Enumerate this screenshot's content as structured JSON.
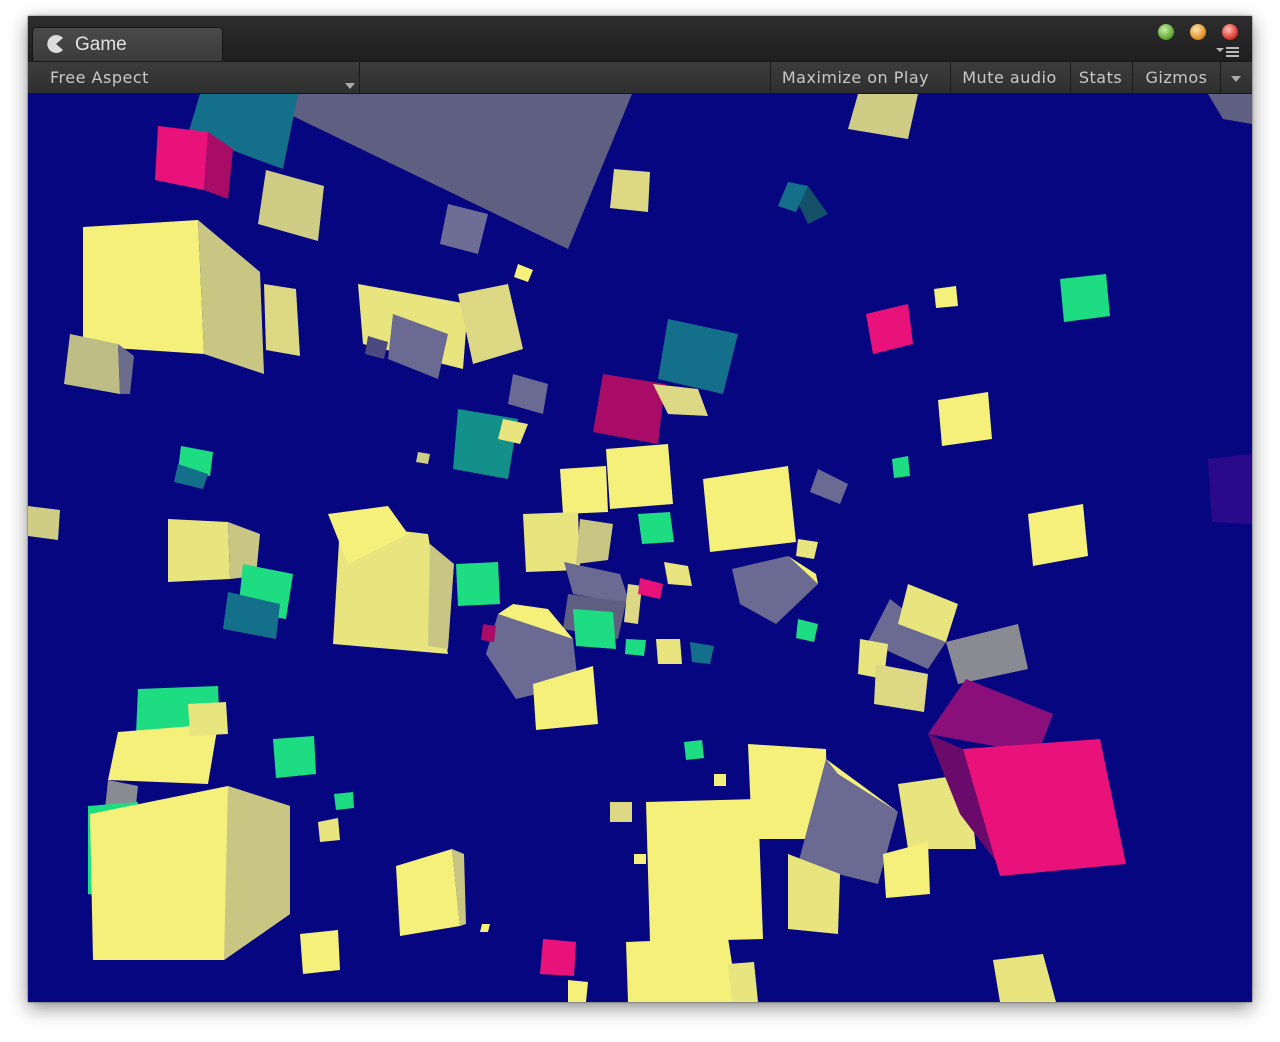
{
  "window": {
    "tab_title": "Game",
    "tab_icon": "pacman-game-icon"
  },
  "toolbar": {
    "aspect_label": "Free Aspect",
    "maximize_label": "Maximize on Play",
    "mute_label": "Mute audio",
    "stats_label": "Stats",
    "gizmos_label": "Gizmos"
  },
  "scene": {
    "background_color": "#060680",
    "cube_colors": {
      "yellow": "#f5f07a",
      "gray_blue": "#5f5f82",
      "teal": "#14708a",
      "green": "#1ddc82",
      "pink": "#e8127a"
    }
  }
}
